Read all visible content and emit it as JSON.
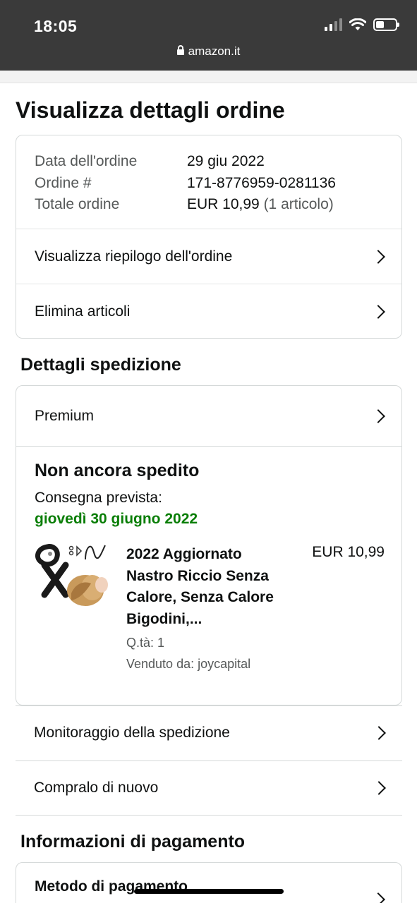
{
  "status_bar": {
    "time": "18:05",
    "url": "amazon.it"
  },
  "page_title": "Visualizza dettagli ordine",
  "order": {
    "rows": [
      {
        "label": "Data dell'ordine",
        "value": "29 giu 2022",
        "extra": ""
      },
      {
        "label": "Ordine #",
        "value": "171-8776959-0281136",
        "extra": ""
      },
      {
        "label": "Totale ordine",
        "value": "EUR 10,99",
        "extra": " (1 articolo)"
      }
    ],
    "summary_link": "Visualizza riepilogo dell'ordine",
    "delete_link": "Elimina articoli"
  },
  "shipping": {
    "section_title": "Dettagli spedizione",
    "premium_label": "Premium",
    "status": "Non ancora spedito",
    "delivery_label": "Consegna prevista:",
    "delivery_date": "giovedì 30 giugno 2022",
    "product": {
      "title": "2022 Aggiornato Nastro Riccio Senza Calore, Senza Calore Bigodini,...",
      "price": "EUR 10,99",
      "qty": "Q.tà: 1",
      "seller": "Venduto da: joycapital"
    },
    "track_link": "Monitoraggio della spedizione",
    "buy_again_link": "Compralo di nuovo"
  },
  "payment": {
    "section_title": "Informazioni di pagamento",
    "method_label": "Metodo di pagamento"
  },
  "colors": {
    "delivery_green": "#0a7e07",
    "border": "#d5d9d9",
    "text": "#0f1111",
    "muted": "#565959"
  }
}
